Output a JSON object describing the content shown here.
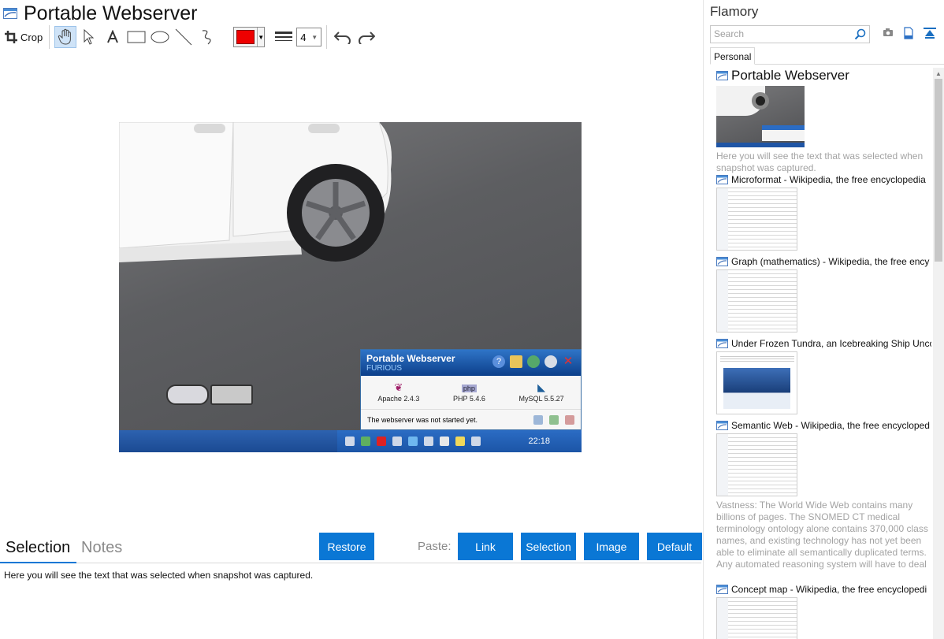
{
  "snapshot": {
    "title": "Portable Webserver"
  },
  "toolbar": {
    "crop_label": "Crop",
    "color_value": "#ee0000",
    "width_value": "4"
  },
  "image": {
    "window_title": "Portable Webserver",
    "window_subtitle": "FURIOUS",
    "services": [
      {
        "name": "Apache 2.4.3"
      },
      {
        "name": "PHP 5.4.6"
      },
      {
        "name": "MySQL 5.5.27"
      }
    ],
    "status": "The webserver was not started yet.",
    "clock": "22:18",
    "php_badge": "php"
  },
  "bottom": {
    "tabs": [
      "Selection",
      "Notes"
    ],
    "restore_label": "Restore",
    "paste_label": "Paste:",
    "paste_buttons": [
      "Link",
      "Selection",
      "Image",
      "Default"
    ],
    "selection_text": "Here you will see the text that was selected when snapshot was captured."
  },
  "sidebar": {
    "app_name": "Flamory",
    "search_placeholder": "Search",
    "tab_label": "Personal",
    "items": [
      {
        "title": "Portable Webserver",
        "desc": "Here you will see the text that was selected when snapshot was captured."
      },
      {
        "title": "Microformat - Wikipedia, the free encyclopedia"
      },
      {
        "title": "Graph (mathematics) - Wikipedia, the free ency"
      },
      {
        "title": "Under Frozen Tundra, an Icebreaking Ship Unco"
      },
      {
        "title": "Semantic Web - Wikipedia, the free encycloped",
        "desc": "Vastness: The World Wide Web contains many billions of pages. The SNOMED CT medical terminology ontology alone contains 370,000 class names, and existing technology has not yet been able to eliminate all semantically duplicated terms. Any automated reasoning system will have to deal with truly huge inputs."
      },
      {
        "title": "Concept map - Wikipedia, the free encyclopedi"
      }
    ]
  },
  "colors": {
    "accent": "#0a77d5",
    "active_tool_bg": "#cfe3f7"
  }
}
